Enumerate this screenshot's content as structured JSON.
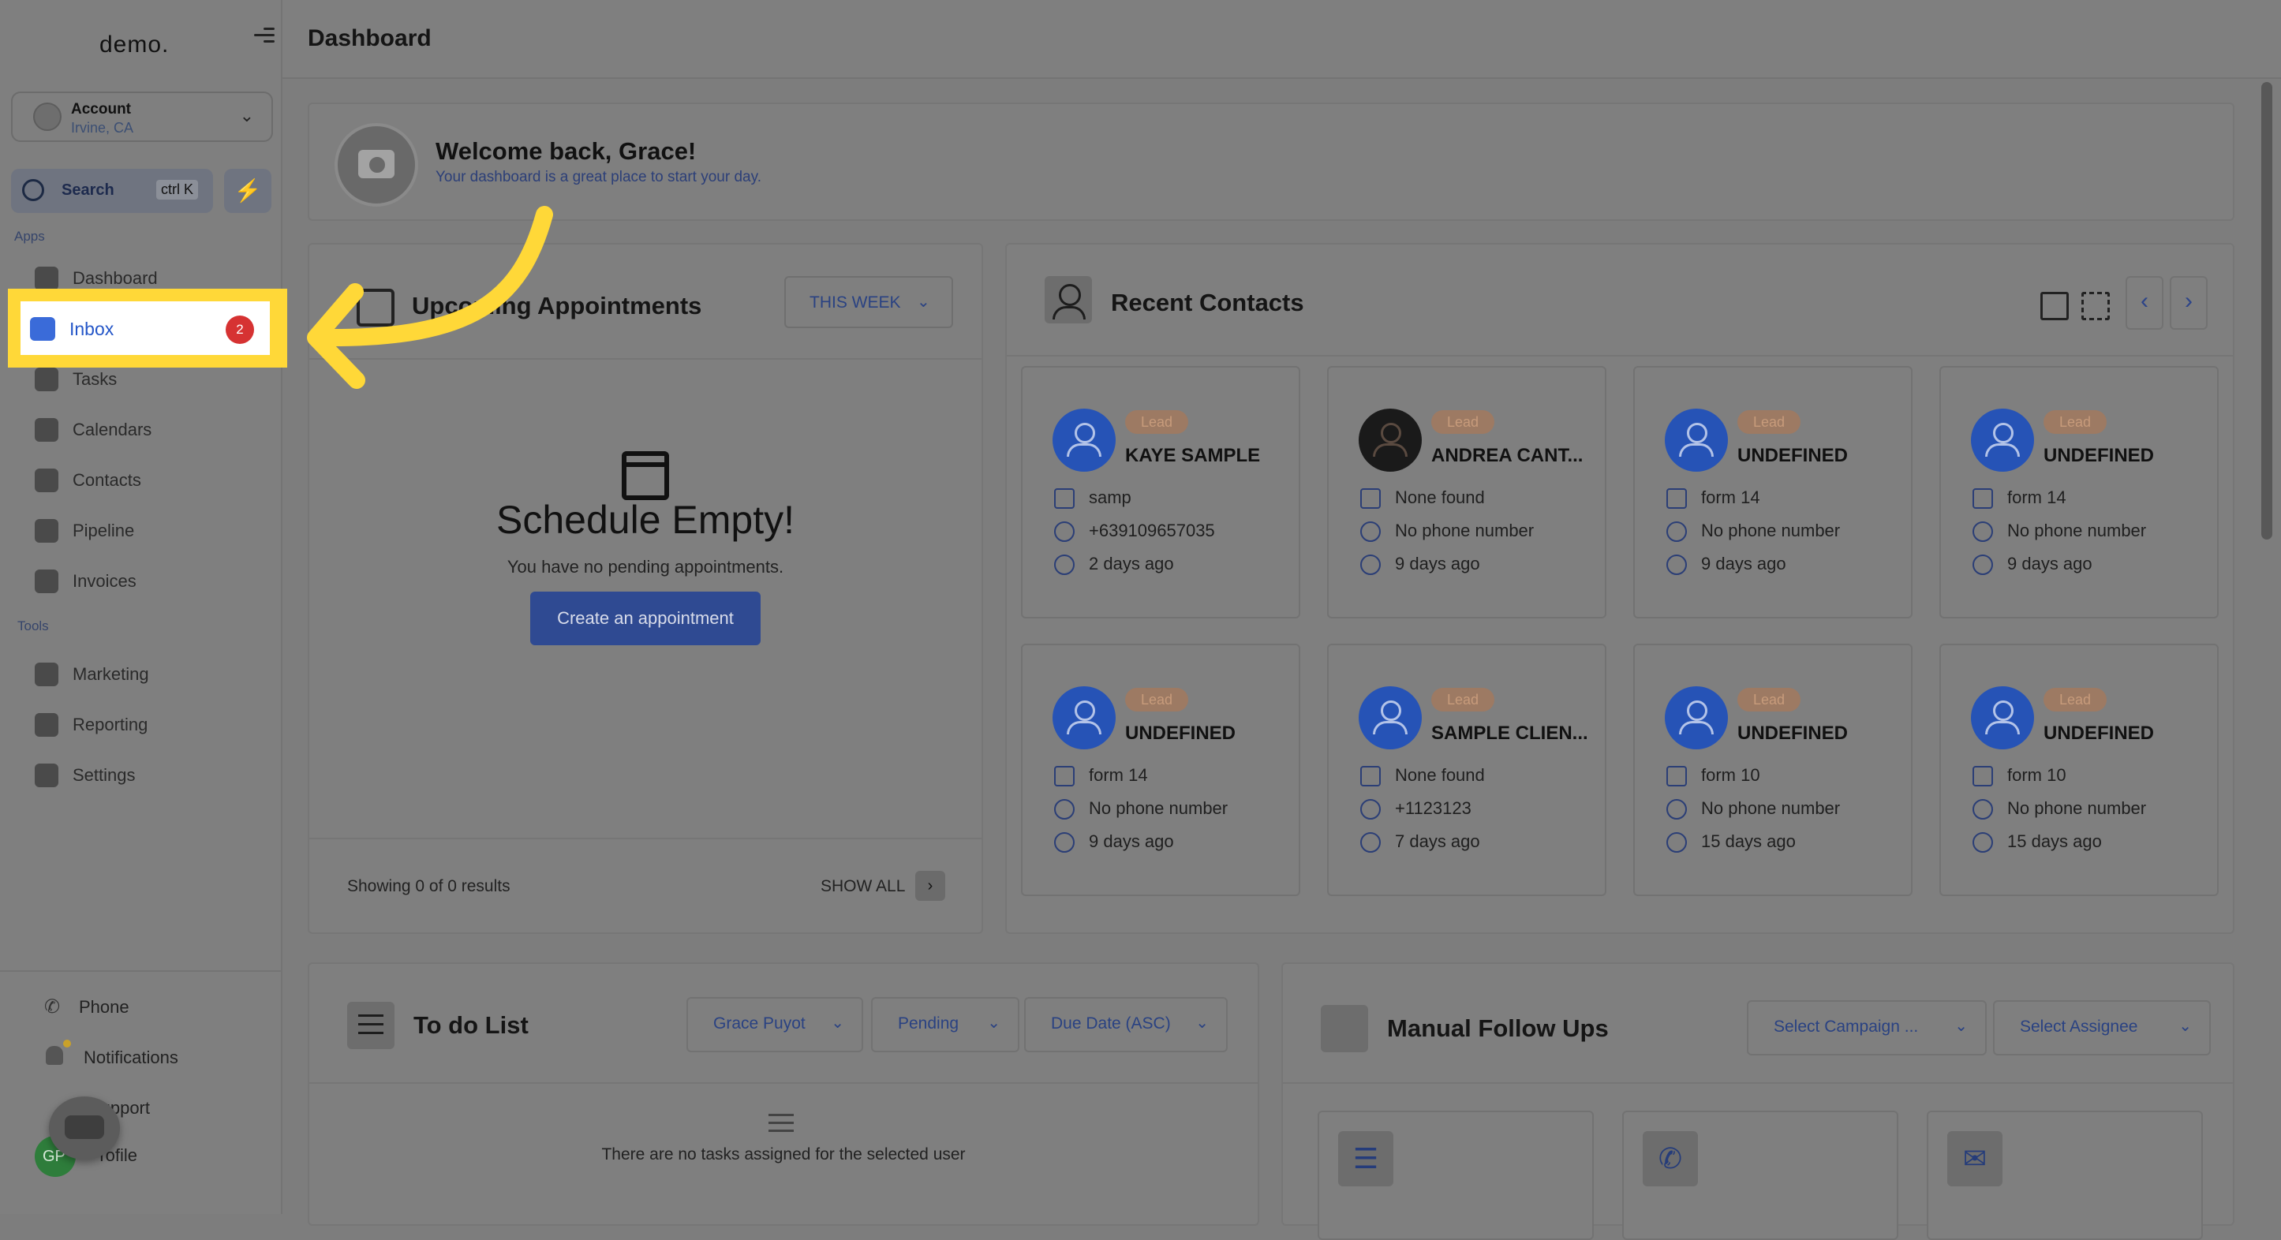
{
  "sidebar": {
    "logo": "demo.",
    "account": {
      "name": "Account",
      "location": "Irvine, CA"
    },
    "search": {
      "label": "Search",
      "shortcut": "ctrl K"
    },
    "apps_label": "Apps",
    "tools_label": "Tools",
    "apps": [
      {
        "label": "Dashboard"
      },
      {
        "label": "Inbox",
        "badge": "2"
      },
      {
        "label": "Tasks"
      },
      {
        "label": "Calendars"
      },
      {
        "label": "Contacts"
      },
      {
        "label": "Pipeline"
      },
      {
        "label": "Invoices"
      }
    ],
    "tools": [
      {
        "label": "Marketing"
      },
      {
        "label": "Reporting"
      },
      {
        "label": "Settings"
      }
    ],
    "bottom": [
      {
        "label": "Phone"
      },
      {
        "label": "Notifications"
      },
      {
        "label": "Support"
      },
      {
        "label": "Profile"
      }
    ],
    "avatar_initials": "GP"
  },
  "header": {
    "title": "Dashboard"
  },
  "welcome": {
    "title": "Welcome back, Grace!",
    "subtitle": "Your dashboard is a great place to start your day."
  },
  "appointments": {
    "title": "Upcoming Appointments",
    "filter": "THIS WEEK",
    "empty_title": "Schedule Empty!",
    "empty_sub": "You have no pending appointments.",
    "create_label": "Create an appointment",
    "showing": "Showing 0 of 0 results",
    "show_all": "SHOW ALL"
  },
  "recent_contacts": {
    "title": "Recent Contacts",
    "lead_label": "Lead",
    "contacts": [
      {
        "name": "KAYE SAMPLE",
        "company": "samp",
        "phone": "+639109657035",
        "time": "2 days ago"
      },
      {
        "name": "ANDREA CANT...",
        "company": "None found",
        "phone": "No phone number",
        "time": "9 days ago"
      },
      {
        "name": "UNDEFINED",
        "company": "form 14",
        "phone": "No phone number",
        "time": "9 days ago"
      },
      {
        "name": "UNDEFINED",
        "company": "form 14",
        "phone": "No phone number",
        "time": "9 days ago"
      },
      {
        "name": "UNDEFINED",
        "company": "form 14",
        "phone": "No phone number",
        "time": "9 days ago"
      },
      {
        "name": "SAMPLE CLIEN...",
        "company": "None found",
        "phone": "+1123123",
        "time": "7 days ago"
      },
      {
        "name": "UNDEFINED",
        "company": "form 10",
        "phone": "No phone number",
        "time": "15 days ago"
      },
      {
        "name": "UNDEFINED",
        "company": "form 10",
        "phone": "No phone number",
        "time": "15 days ago"
      }
    ]
  },
  "todo": {
    "title": "To do List",
    "filters": [
      "Grace Puyot",
      "Pending",
      "Due Date (ASC)"
    ],
    "empty": "There are no tasks assigned for the selected user"
  },
  "manual_follow_ups": {
    "title": "Manual Follow Ups",
    "campaign_placeholder": "Select Campaign ...",
    "assignee_placeholder": "Select Assignee"
  },
  "colors": {
    "highlight": "#ffd838",
    "accent": "#2456c8",
    "badge": "#d63232"
  }
}
